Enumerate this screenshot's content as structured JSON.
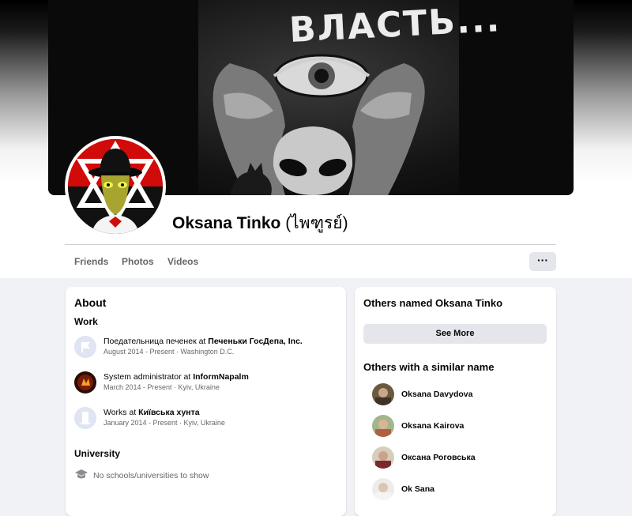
{
  "cover": {
    "artwork_text": "ВЛАСТЬ..."
  },
  "profile": {
    "name": "Oksana Tinko",
    "alternate_name": "(ไพฑูรย์)"
  },
  "nav": {
    "tabs": [
      "Friends",
      "Photos",
      "Videos"
    ],
    "more_label": "···"
  },
  "about": {
    "title": "About",
    "work_heading": "Work",
    "work": [
      {
        "role": "Поедательница печенек at",
        "org": "Печеньки ГосДепа, Inc.",
        "meta": "August 2014 - Present · Washington D.C.",
        "icon": "flag-icon"
      },
      {
        "role": "System administrator at",
        "org": "InformNapalm",
        "meta": "March 2014 - Present · Kyiv, Ukraine",
        "icon": "informnapalm-logo"
      },
      {
        "role": "Works at",
        "org": "Київська хунта",
        "meta": "January 2014 - Present · Kyiv, Ukraine",
        "icon": "person-icon"
      }
    ],
    "university_heading": "University",
    "no_school_text": "No schools/universities to show"
  },
  "others": {
    "named_title": "Others named Oksana Tinko",
    "see_more_label": "See More",
    "similar_title": "Others with a similar name",
    "people": [
      {
        "name": "Oksana Davydova"
      },
      {
        "name": "Oksana Kairova"
      },
      {
        "name": "Оксана Роговська"
      },
      {
        "name": "Ok Sana"
      }
    ]
  },
  "colors": {
    "page_bg": "#f0f2f5",
    "button_bg": "#e4e6eb",
    "secondary_text": "#65676b",
    "avatar_red": "#d10a0a"
  }
}
